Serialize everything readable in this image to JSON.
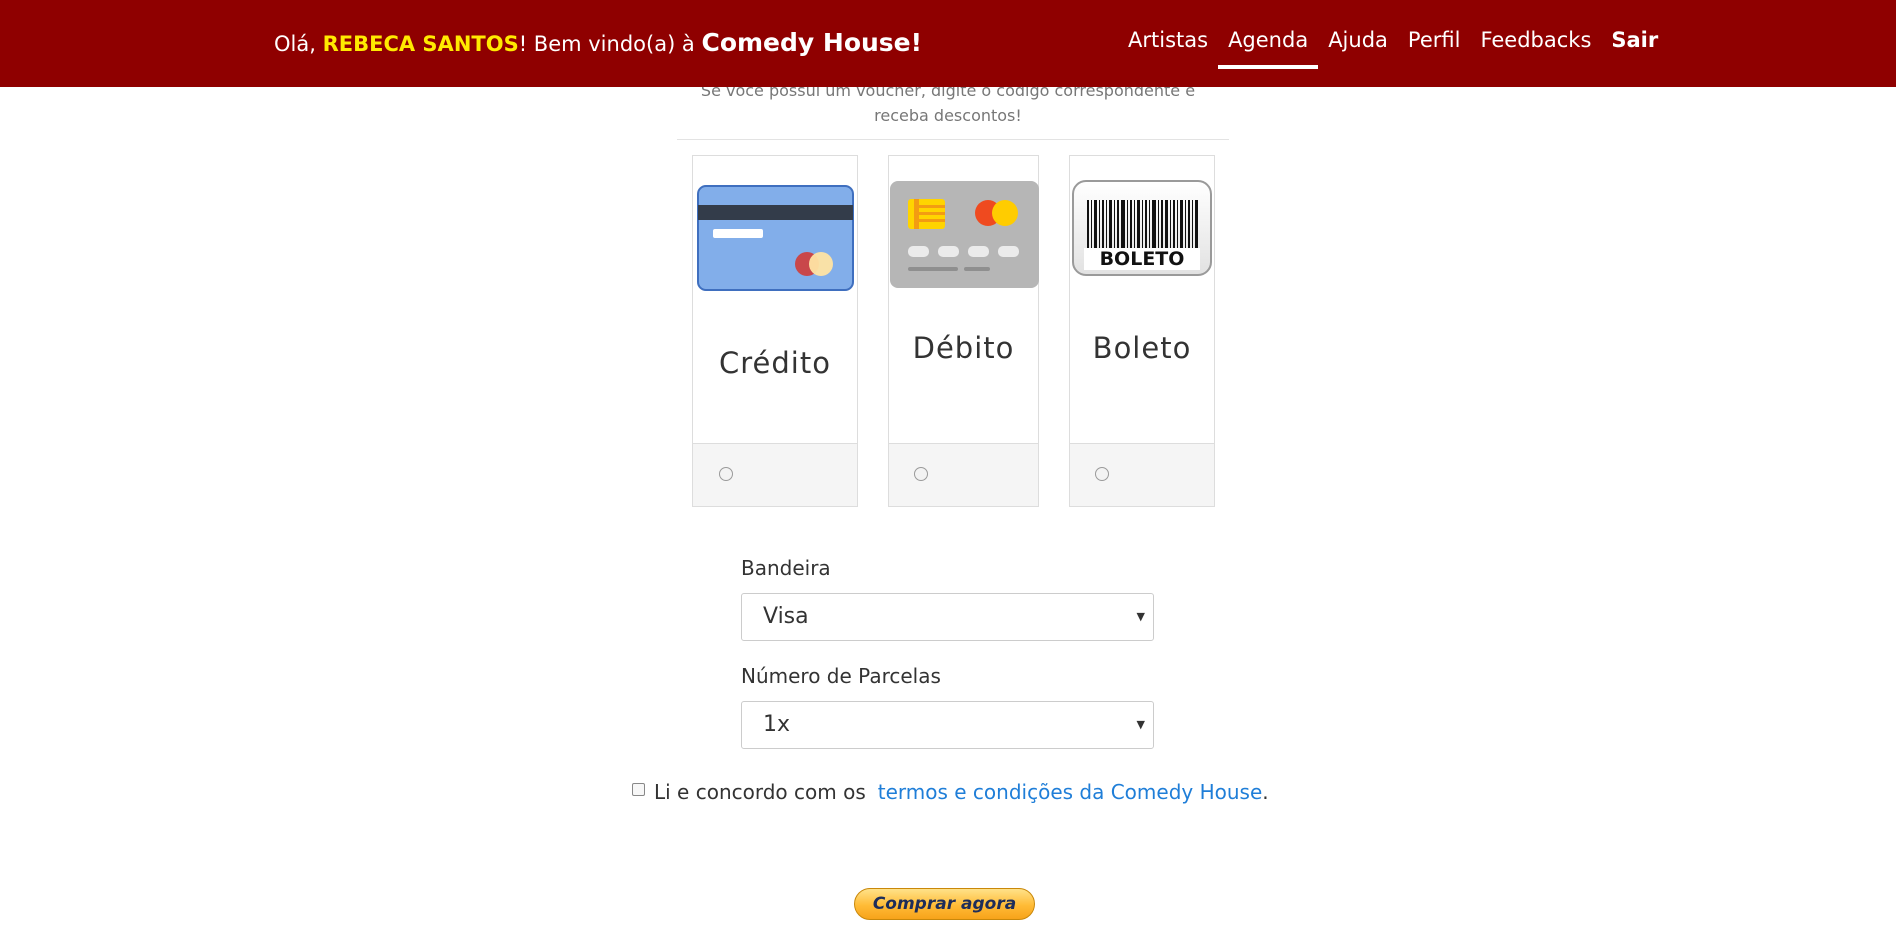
{
  "header": {
    "greeting_prefix": "Olá, ",
    "user_name": "REBECA SANTOS",
    "greeting_middle": "! Bem vindo(a) à ",
    "brand": "Comedy House!",
    "nav": [
      "Artistas",
      "Agenda",
      "Ajuda",
      "Perfil",
      "Feedbacks",
      "Sair"
    ],
    "active_nav": "Agenda"
  },
  "promo": {
    "line1": "Se você possui um voucher, digite o código correspondente e",
    "line2": "receba descontos!"
  },
  "payment_methods": [
    {
      "label": "Crédito",
      "icon": "credit-card-icon",
      "selected": false
    },
    {
      "label": "Débito",
      "icon": "debit-card-icon",
      "selected": false
    },
    {
      "label": "Boleto",
      "icon": "barcode-icon",
      "icon_text": "BOLETO",
      "selected": false
    }
  ],
  "form": {
    "bandeira_label": "Bandeira",
    "bandeira_value": "Visa",
    "parcelas_label": "Número de Parcelas",
    "parcelas_value": "1x"
  },
  "terms": {
    "text": "Li e concordo com os",
    "link": "termos e condições da Comedy House",
    "suffix": ".",
    "checked": false
  },
  "buy_button": "Comprar agora",
  "colors": {
    "header_bg": "#8f0000",
    "user_name": "#ffea00",
    "link": "#1f7ed8"
  }
}
